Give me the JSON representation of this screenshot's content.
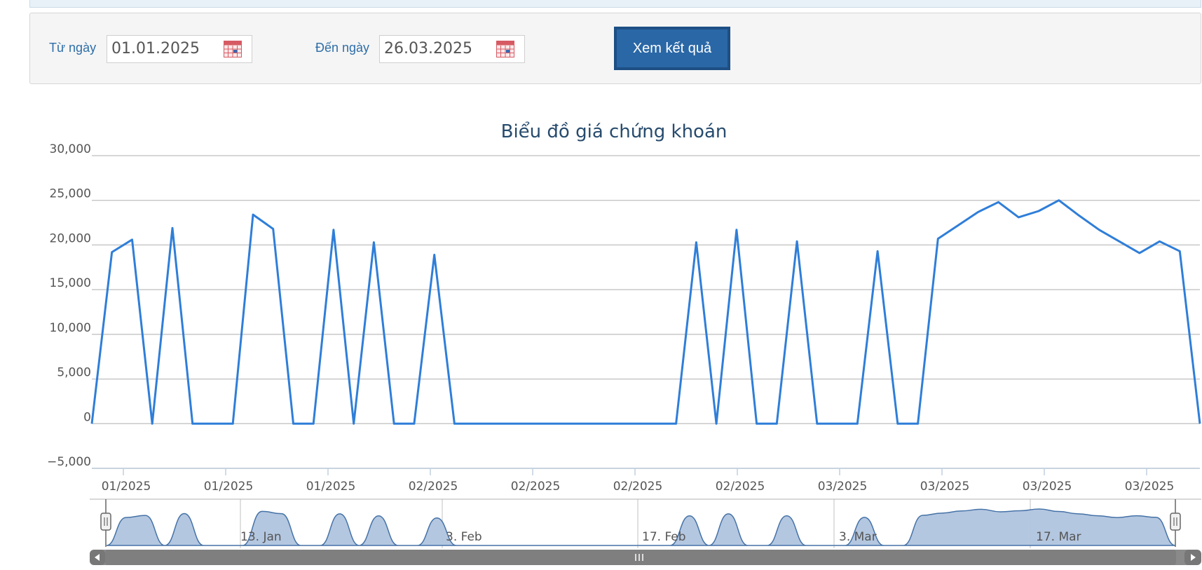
{
  "filter": {
    "from_label": "Từ ngày",
    "from_value": "01.01.2025",
    "to_label": "Đến ngày",
    "to_value": "26.03.2025",
    "submit_label": "Xem kết quả"
  },
  "colors": {
    "accent": "#2f7ed8",
    "navigator_fill": "#b0c4de",
    "button": "#2a67a6"
  },
  "chart_data": {
    "type": "line",
    "title": "Biểu đồ giá chứng khoán",
    "xlabel": "",
    "ylabel": "",
    "ylim": [
      -5000,
      30000
    ],
    "yticks": [
      "30,000",
      "25,000",
      "20,000",
      "15,000",
      "10,000",
      "5,000",
      "0",
      "−5,000"
    ],
    "ytick_values": [
      30000,
      25000,
      20000,
      15000,
      10000,
      5000,
      0,
      -5000
    ],
    "xticks": [
      "01/2025",
      "01/2025",
      "01/2025",
      "02/2025",
      "02/2025",
      "02/2025",
      "02/2025",
      "03/2025",
      "03/2025",
      "03/2025",
      "03/2025"
    ],
    "grid": true,
    "series": [
      {
        "values": [
          0,
          19200,
          20600,
          0,
          21900,
          0,
          0,
          0,
          23400,
          21800,
          0,
          0,
          21700,
          0,
          20300,
          0,
          0,
          18900,
          0,
          0,
          0,
          0,
          0,
          0,
          0,
          0,
          0,
          0,
          0,
          0,
          20300,
          0,
          21700,
          0,
          0,
          20400,
          0,
          0,
          0,
          19300,
          0,
          0,
          20700,
          22200,
          23700,
          24800,
          23100,
          23800,
          25000,
          23300,
          21700,
          20400,
          19100,
          20400,
          19300,
          0
        ]
      }
    ],
    "navigator": {
      "labels": [
        "13. Jan",
        "3. Feb",
        "17. Feb",
        "3. Mar",
        "17. Mar"
      ]
    }
  }
}
